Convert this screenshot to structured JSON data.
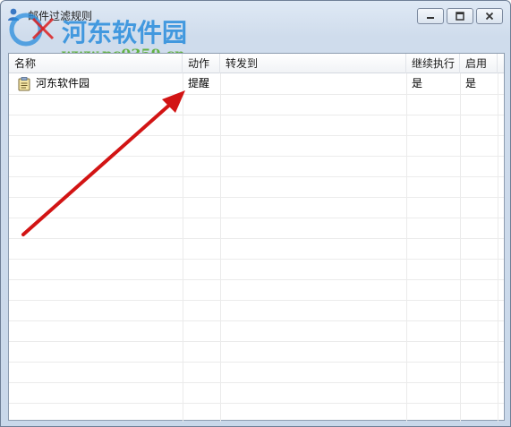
{
  "window": {
    "title": "邮件过滤规则",
    "minimize_label": "minimize",
    "maximize_label": "maximize",
    "close_label": "close"
  },
  "watermark": {
    "title": "河东软件园",
    "url": "www.pc0359.cn"
  },
  "table": {
    "columns": [
      {
        "label": "名称"
      },
      {
        "label": "动作"
      },
      {
        "label": "转发到"
      },
      {
        "label": "继续执行"
      },
      {
        "label": "启用"
      }
    ],
    "rows": [
      {
        "icon": "note-icon",
        "name": "河东软件园",
        "action": "提醒",
        "forward_to": "",
        "continue": "是",
        "enabled": "是"
      }
    ]
  },
  "colors": {
    "arrow": "#d21414",
    "watermark_title": "#288cdc",
    "watermark_url": "#50aa28"
  }
}
